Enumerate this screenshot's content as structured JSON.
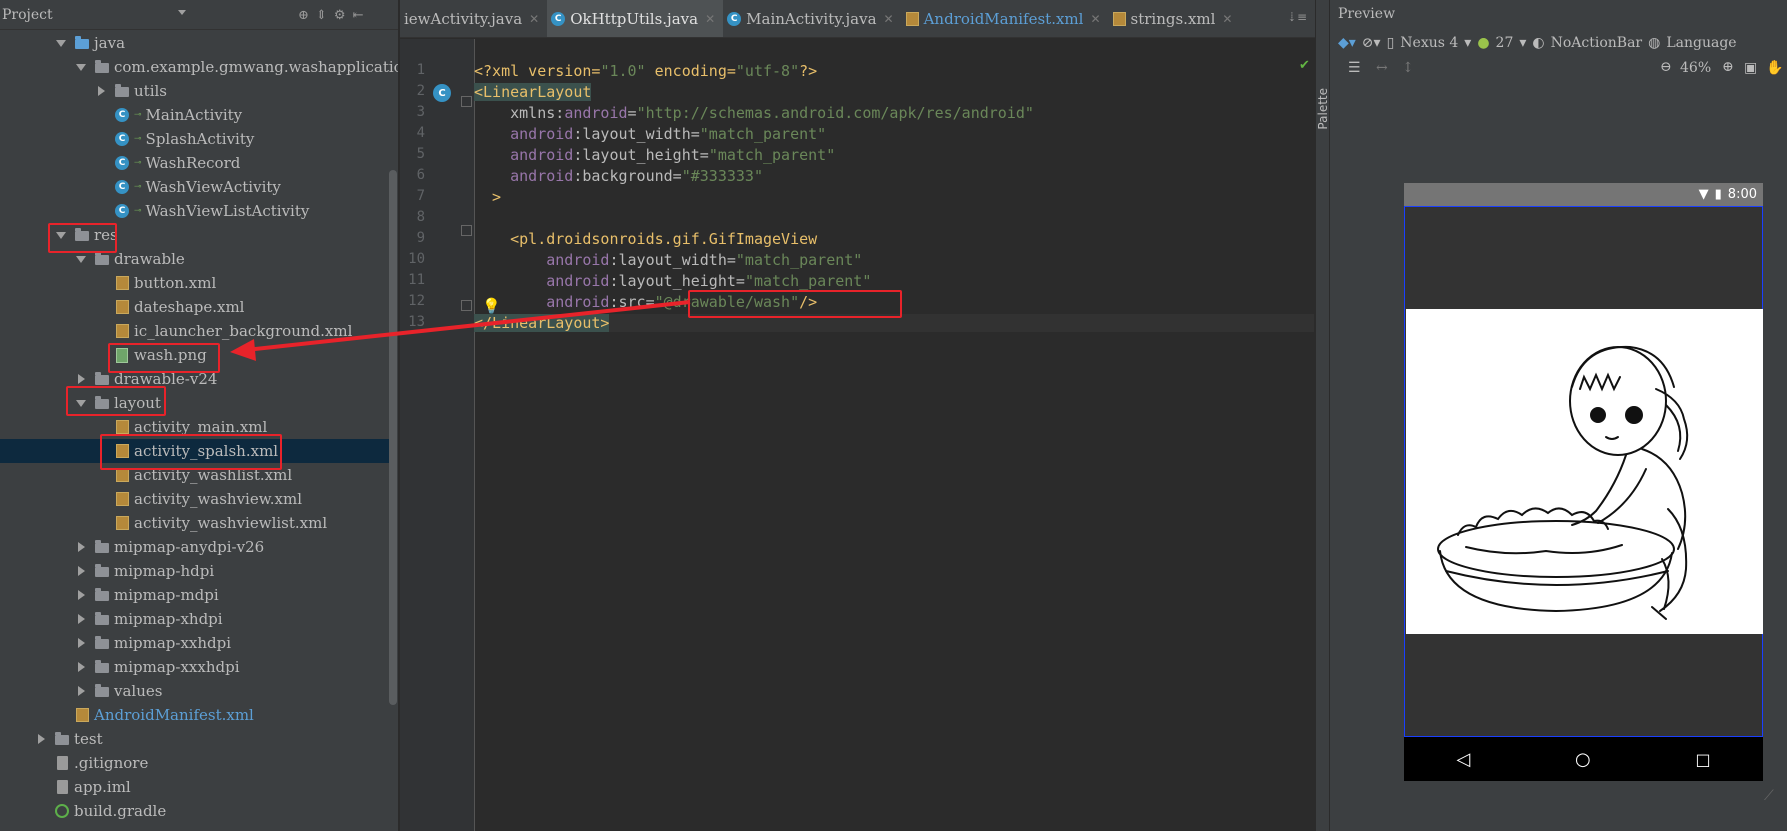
{
  "project": {
    "title": "Project",
    "tree": [
      {
        "label": "java",
        "depth": 1,
        "state": "open",
        "icon": "folder-blue"
      },
      {
        "label": "com.example.gmwang.washapplication",
        "depth": 2,
        "state": "open",
        "icon": "folder"
      },
      {
        "label": "utils",
        "depth": 3,
        "state": "closed",
        "icon": "folder"
      },
      {
        "label": "MainActivity",
        "depth": 3,
        "state": "none",
        "icon": "class"
      },
      {
        "label": "SplashActivity",
        "depth": 3,
        "state": "none",
        "icon": "class"
      },
      {
        "label": "WashRecord",
        "depth": 3,
        "state": "none",
        "icon": "class"
      },
      {
        "label": "WashViewActivity",
        "depth": 3,
        "state": "none",
        "icon": "class"
      },
      {
        "label": "WashViewListActivity",
        "depth": 3,
        "state": "none",
        "icon": "class"
      },
      {
        "label": "res",
        "depth": 1,
        "state": "open",
        "icon": "folder"
      },
      {
        "label": "drawable",
        "depth": 2,
        "state": "open",
        "icon": "folder"
      },
      {
        "label": "button.xml",
        "depth": 3,
        "state": "none",
        "icon": "xml"
      },
      {
        "label": "dateshape.xml",
        "depth": 3,
        "state": "none",
        "icon": "xml"
      },
      {
        "label": "ic_launcher_background.xml",
        "depth": 3,
        "state": "none",
        "icon": "xml"
      },
      {
        "label": "wash.png",
        "depth": 3,
        "state": "none",
        "icon": "png"
      },
      {
        "label": "drawable-v24",
        "depth": 2,
        "state": "closed",
        "icon": "folder"
      },
      {
        "label": "layout",
        "depth": 2,
        "state": "open",
        "icon": "folder"
      },
      {
        "label": "activity_main.xml",
        "depth": 3,
        "state": "none",
        "icon": "xml"
      },
      {
        "label": "activity_spalsh.xml",
        "depth": 3,
        "state": "none",
        "icon": "xml",
        "selected": true
      },
      {
        "label": "activity_washlist.xml",
        "depth": 3,
        "state": "none",
        "icon": "xml"
      },
      {
        "label": "activity_washview.xml",
        "depth": 3,
        "state": "none",
        "icon": "xml"
      },
      {
        "label": "activity_washviewlist.xml",
        "depth": 3,
        "state": "none",
        "icon": "xml"
      },
      {
        "label": "mipmap-anydpi-v26",
        "depth": 2,
        "state": "closed",
        "icon": "folder"
      },
      {
        "label": "mipmap-hdpi",
        "depth": 2,
        "state": "closed",
        "icon": "folder"
      },
      {
        "label": "mipmap-mdpi",
        "depth": 2,
        "state": "closed",
        "icon": "folder"
      },
      {
        "label": "mipmap-xhdpi",
        "depth": 2,
        "state": "closed",
        "icon": "folder"
      },
      {
        "label": "mipmap-xxhdpi",
        "depth": 2,
        "state": "closed",
        "icon": "folder"
      },
      {
        "label": "mipmap-xxxhdpi",
        "depth": 2,
        "state": "closed",
        "icon": "folder"
      },
      {
        "label": "values",
        "depth": 2,
        "state": "closed",
        "icon": "folder"
      },
      {
        "label": "AndroidManifest.xml",
        "depth": 1,
        "state": "none",
        "icon": "xml",
        "blue": true
      },
      {
        "label": "test",
        "depth": 0,
        "state": "closed",
        "icon": "folder"
      },
      {
        "label": ".gitignore",
        "depth": 0,
        "state": "none",
        "icon": "file"
      },
      {
        "label": "app.iml",
        "depth": 0,
        "state": "none",
        "icon": "file"
      },
      {
        "label": "build.gradle",
        "depth": 0,
        "state": "none",
        "icon": "gradle"
      }
    ]
  },
  "editor": {
    "tabs": [
      {
        "label": "iewActivity.java",
        "icon": "none",
        "active": false
      },
      {
        "label": "OkHttpUtils.java",
        "icon": "class",
        "active": true
      },
      {
        "label": "MainActivity.java",
        "icon": "class",
        "active": false
      },
      {
        "label": "AndroidManifest.xml",
        "icon": "xml",
        "active": false,
        "blue": true
      },
      {
        "label": "strings.xml",
        "icon": "xml",
        "active": false
      }
    ],
    "tabs_more": "⇣≡",
    "line_numbers": [
      "1",
      "2",
      "3",
      "4",
      "5",
      "6",
      "7",
      "8",
      "9",
      "10",
      "11",
      "12",
      "13"
    ],
    "code": {
      "l1_decl_open": "<?xml version=",
      "l1_ver": "\"1.0\"",
      "l1_enc": " encoding=",
      "l1_encval": "\"utf-8\"",
      "l1_close": "?>",
      "l2_tag": "<LinearLayout",
      "l3_attr": "    xmlns:",
      "l3_ns": "android",
      "l3_eq": "=",
      "l3_val": "\"http://schemas.android.com/apk/res/android\"",
      "l4_ns": "    android",
      "l4_attr": ":layout_width=",
      "l4_val": "\"match_parent\"",
      "l5_ns": "    android",
      "l5_attr": ":layout_height=",
      "l5_val": "\"match_parent\"",
      "l6_ns": "    android",
      "l6_attr": ":background=",
      "l6_val": "\"#333333\"",
      "l7": "  >",
      "l9_tag": "    <pl.droidsonroids.gif.GifImageView",
      "l10_ns": "        android",
      "l10_attr": ":layout_width=",
      "l10_val": "\"match_parent\"",
      "l11_ns": "        android",
      "l11_attr": ":layout_height=",
      "l11_val": "\"match_parent\"",
      "l12_ns": "        android",
      "l12_attr": ":src=",
      "l12_val": "\"@drawable/wash\"",
      "l12_close": "/>",
      "l13_tag": "</LinearLayout>"
    }
  },
  "palette": {
    "label": "Palette"
  },
  "preview": {
    "title": "Preview",
    "device": "Nexus 4",
    "api": "27",
    "theme": "NoActionBar",
    "language": "Language",
    "zoom": "46%",
    "status_time": "8:00",
    "screen_background": "#333333"
  },
  "colors": {
    "annotation_red": "#e8232a",
    "selection": "#0d293e"
  }
}
